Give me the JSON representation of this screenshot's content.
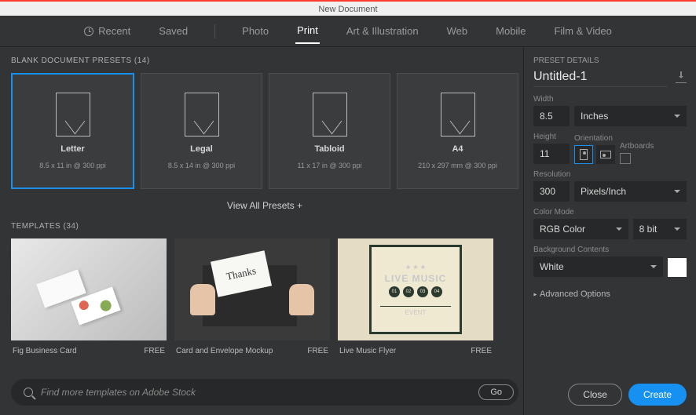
{
  "window": {
    "title": "New Document"
  },
  "tabs": {
    "recent": "Recent",
    "saved": "Saved",
    "photo": "Photo",
    "print": "Print",
    "art": "Art & Illustration",
    "web": "Web",
    "mobile": "Mobile",
    "film": "Film & Video"
  },
  "presets": {
    "heading": "BLANK DOCUMENT PRESETS  (14)",
    "items": [
      {
        "name": "Letter",
        "dims": "8.5 x 11 in @ 300 ppi"
      },
      {
        "name": "Legal",
        "dims": "8.5 x 14 in @ 300 ppi"
      },
      {
        "name": "Tabloid",
        "dims": "11 x 17 in @ 300 ppi"
      },
      {
        "name": "A4",
        "dims": "210 x 297 mm @ 300 ppi"
      }
    ],
    "viewall": "View All Presets  +"
  },
  "templates": {
    "heading": "TEMPLATES  (34)",
    "items": [
      {
        "name": "Fig Business Card",
        "price": "FREE"
      },
      {
        "name": "Card and Envelope Mockup",
        "price": "FREE"
      },
      {
        "name": "Live Music Flyer",
        "price": "FREE"
      }
    ]
  },
  "search": {
    "placeholder": "Find more templates on Adobe Stock",
    "go": "Go"
  },
  "details": {
    "heading": "PRESET DETAILS",
    "docname": "Untitled-1",
    "width_label": "Width",
    "width": "8.5",
    "units": "Inches",
    "height_label": "Height",
    "height": "11",
    "orientation_label": "Orientation",
    "artboards_label": "Artboards",
    "resolution_label": "Resolution",
    "resolution": "300",
    "res_units": "Pixels/Inch",
    "colormode_label": "Color Mode",
    "colormode": "RGB Color",
    "bitdepth": "8 bit",
    "bg_label": "Background Contents",
    "bg": "White",
    "bg_color": "#ffffff",
    "advanced": "Advanced Options"
  },
  "buttons": {
    "close": "Close",
    "create": "Create"
  }
}
